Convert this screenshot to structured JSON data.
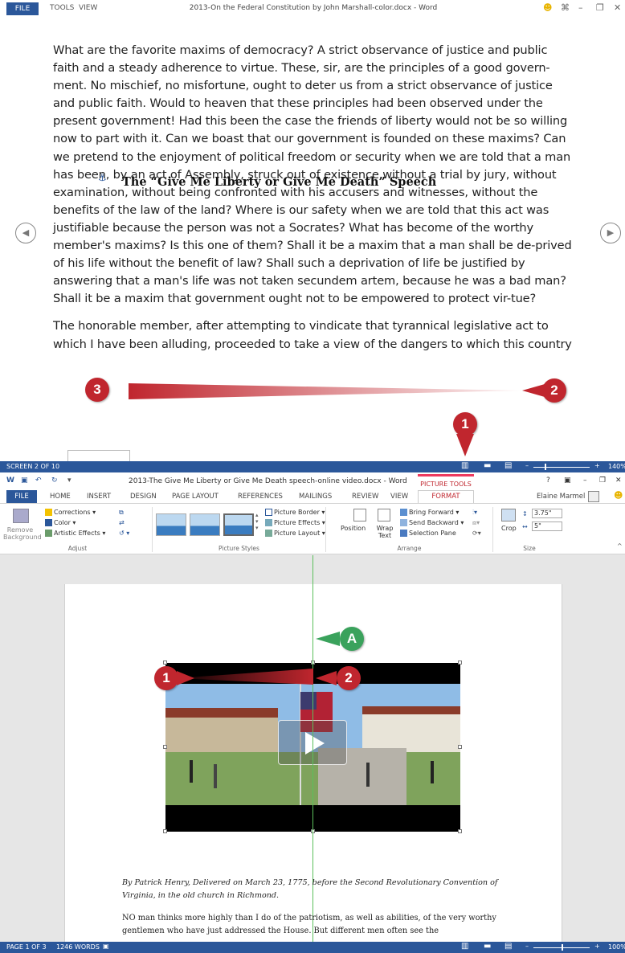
{
  "top_window": {
    "menu": {
      "file": "FILE",
      "tools": "TOOLS",
      "view": "VIEW"
    },
    "title": "2013-On the Federal Constitution by John Marshall-color.docx - Word",
    "paragraphs": [
      "What are the favorite maxims of democracy? A strict observance of justice and public faith and a steady adherence to virtue. These, sir, are the principles of a good govern-ment. No mischief, no misfortune, ought to deter us from a strict observance of justice and public faith. Would to heaven that these principles had been observed under the present government! Had this been the case the friends of liberty would not be so willing now to part with it. Can we boast that our government is founded on these maxims? Can we pretend to the enjoyment of political freedom or security when we are told that a man has been, by an act of Assembly, struck out of existence without a trial by jury, without examination, without being confronted with his accusers and witnesses, without the benefits of the law of the land? Where is our safety when we are told that this act was justifiable because the person was not a Socrates? What has become of the worthy member's maxims? Is this one of them? Shall it be a maxim that a man shall be de-prived of his life without the benefit of law? Shall such a deprivation of life be justified by answering that a man's life was not taken secundem artem, because he was a bad man? Shall it be a maxim that government ought not to be empowered to protect vir-tue?",
      "The honorable member, after attempting to vindicate that tyrannical legislative act to which I have been alluding, proceeded to take a view of the dangers to which this country is exposed. He told us that the principal danger arose from a government which adopted would give away the Mississippi"
    ],
    "status": {
      "screen": "SCREEN 2 OF 10",
      "zoom": "140%"
    },
    "callouts": {
      "c1": "1",
      "c2": "2",
      "c3": "3"
    }
  },
  "bottom_window": {
    "title": "2013-The Give Me Liberty or Give Me Death speech-online video.docx - Word",
    "picture_tools": "PICTURE TOOLS",
    "window_ctrl": {
      "help": "?",
      "min": "–"
    },
    "tabs": [
      "HOME",
      "INSERT",
      "DESIGN",
      "PAGE LAYOUT",
      "REFERENCES",
      "MAILINGS",
      "REVIEW",
      "VIEW"
    ],
    "file_tab": "FILE",
    "format_tab": "FORMAT",
    "user": "Elaine Marmel",
    "ribbon": {
      "remove_background": "Remove Background",
      "corrections": "Corrections",
      "color": "Color",
      "artistic_effects": "Artistic Effects",
      "adjust": "Adjust",
      "picture_border": "Picture Border",
      "picture_effects": "Picture Effects",
      "picture_layout": "Picture Layout",
      "picture_styles": "Picture Styles",
      "position": "Position",
      "wrap_text": "Wrap Text",
      "bring_forward": "Bring Forward",
      "send_backward": "Send Backward",
      "selection_pane": "Selection Pane",
      "arrange": "Arrange",
      "crop": "Crop",
      "height": "3.75\"",
      "width": "5\"",
      "size": "Size"
    },
    "heading": "The “Give Me Liberty or Give Me Death” Speech",
    "caption": "By Patrick Henry, Delivered on March 23, 1775, before the Second Revolutionary Convention of Virginia, in the old church in Richmond.",
    "body": "NO man thinks more highly than I do of the patriotism, as well as abilities, of the very worthy gentlemen who have just addressed the House. But different men often see the",
    "status": {
      "page": "PAGE 1 OF 3",
      "words": "1246 WORDS",
      "zoom": "100%"
    },
    "callouts": {
      "c1": "1",
      "c2": "2",
      "a": "A"
    }
  },
  "colors": {
    "word_blue": "#2b579a",
    "callout_red": "#c0262e",
    "callout_green": "#3aa25c",
    "picture_tools_pink": "#ee3a5f",
    "guide_green": "#5bbf5b"
  }
}
